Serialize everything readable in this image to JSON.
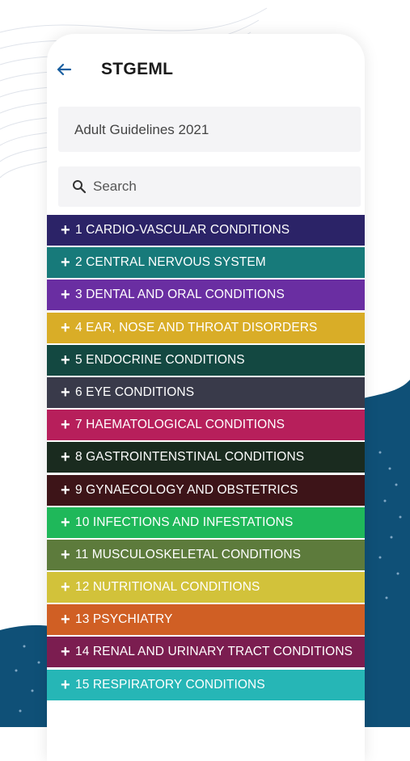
{
  "app": {
    "title": "STGEML",
    "back_icon": "arrow-left-icon"
  },
  "guideline": {
    "selected": "Adult Guidelines 2021"
  },
  "search": {
    "placeholder": "Search",
    "value": ""
  },
  "colors": {
    "accent": "#1a5fa0",
    "background_wave": "#0f5077"
  },
  "categories": [
    {
      "label": "1 CARDIO-VASCULAR CONDITIONS",
      "color": "#2b2367"
    },
    {
      "label": "2 CENTRAL NERVOUS SYSTEM",
      "color": "#177a7a"
    },
    {
      "label": "3 DENTAL AND ORAL CONDITIONS",
      "color": "#6a2ea2"
    },
    {
      "label": "4 EAR, NOSE AND THROAT DISORDERS",
      "color": "#d9ad27"
    },
    {
      "label": "5 ENDOCRINE CONDITIONS",
      "color": "#134841"
    },
    {
      "label": "6 EYE CONDITIONS",
      "color": "#393a4a"
    },
    {
      "label": "7 HAEMATOLOGICAL CONDITIONS",
      "color": "#b71f5b"
    },
    {
      "label": "8 GASTROINTENSTINAL CONDITIONS",
      "color": "#1a2b1f"
    },
    {
      "label": "9 GYNAECOLOGY AND OBSTETRICS",
      "color": "#3d1418"
    },
    {
      "label": "10 INFECTIONS AND INFESTATIONS",
      "color": "#1fb85a"
    },
    {
      "label": "11 MUSCULOSKELETAL CONDITIONS",
      "color": "#5d7b3c"
    },
    {
      "label": "12 NUTRITIONAL CONDITIONS",
      "color": "#d2c23a"
    },
    {
      "label": "13 PSYCHIATRY",
      "color": "#d05f24"
    },
    {
      "label": "14 RENAL AND URINARY TRACT CONDITIONS",
      "color": "#7b1d50"
    },
    {
      "label": "15 RESPIRATORY CONDITIONS",
      "color": "#26b6b6"
    }
  ]
}
